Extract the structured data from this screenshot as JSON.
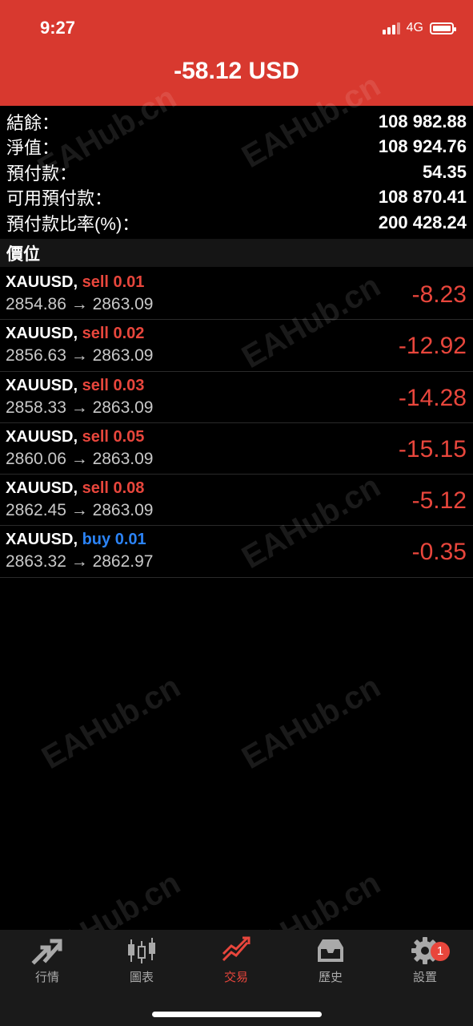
{
  "status_bar": {
    "time": "9:27",
    "network": "4G"
  },
  "header": {
    "title": "-58.12 USD"
  },
  "summary": [
    {
      "label": "結餘：",
      "value": "108 982.88"
    },
    {
      "label": "淨值：",
      "value": "108 924.76"
    },
    {
      "label": "預付款：",
      "value": "54.35"
    },
    {
      "label": "可用預付款：",
      "value": "108 870.41"
    },
    {
      "label": "預付款比率(%)：",
      "value": "200 428.24"
    }
  ],
  "positions_header": "價位",
  "positions": [
    {
      "symbol": "XAUUSD,",
      "side": "sell 0.01",
      "prices": "2854.86 → 2863.09",
      "profit": "-8.23"
    },
    {
      "symbol": "XAUUSD,",
      "side": "sell 0.02",
      "prices": "2856.63 → 2863.09",
      "profit": "-12.92"
    },
    {
      "symbol": "XAUUSD,",
      "side": "sell 0.03",
      "prices": "2858.33 → 2863.09",
      "profit": "-14.28"
    },
    {
      "symbol": "XAUUSD,",
      "side": "sell 0.05",
      "prices": "2860.06 → 2863.09",
      "profit": "-15.15"
    },
    {
      "symbol": "XAUUSD,",
      "side": "sell 0.08",
      "prices": "2862.45 → 2863.09",
      "profit": "-5.12"
    },
    {
      "symbol": "XAUUSD,",
      "side": "buy 0.01",
      "prices": "2863.32 → 2862.97",
      "profit": "-0.35"
    }
  ],
  "tabs": [
    {
      "label": "行情",
      "icon": "quotes-arrows-icon"
    },
    {
      "label": "圖表",
      "icon": "candlestick-icon"
    },
    {
      "label": "交易",
      "icon": "trade-chart-icon"
    },
    {
      "label": "歷史",
      "icon": "history-tray-icon"
    },
    {
      "label": "設置",
      "icon": "gear-icon",
      "badge": "1"
    }
  ],
  "watermark": "EAHub.cn",
  "colors": {
    "header": "#d8392f",
    "sell": "#e8463c",
    "buy": "#2b83f6",
    "loss": "#e8463c"
  }
}
